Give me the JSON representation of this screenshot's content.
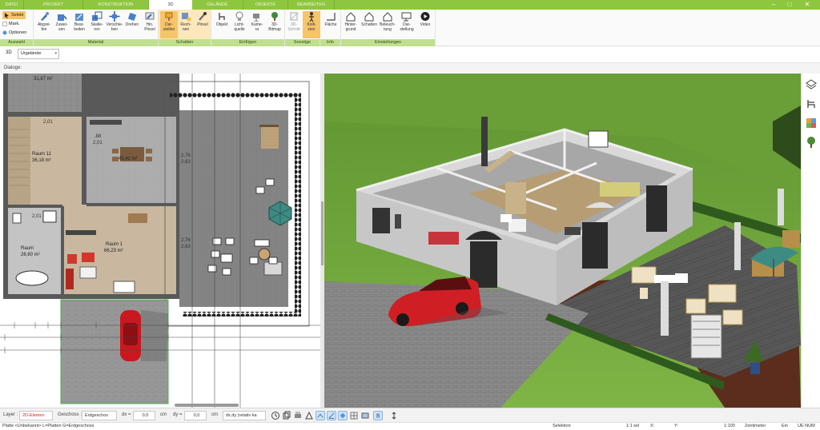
{
  "tabs": [
    {
      "label": "DATEI"
    },
    {
      "label": "PROJEKT"
    },
    {
      "label": "KONSTRUKTION"
    },
    {
      "label": "3D"
    },
    {
      "label": "GELÄNDE"
    },
    {
      "label": "OBJEKTE"
    },
    {
      "label": "BEARBEITEN"
    }
  ],
  "window_controls": {
    "minimize": "–",
    "maximize": "□",
    "close": "✕"
  },
  "ribbon": {
    "auswahl": {
      "label": "Auswahl",
      "selekt": "Selekt",
      "mark": "Mark.",
      "optionen": "Optionen"
    },
    "material": {
      "label": "Material",
      "buttons": [
        "Abgrei-\nfen",
        "Zuwei-\nsen",
        "Bear-\nbeiten",
        "Skalie-\nren",
        "Verschie-\nben",
        "Drehen",
        "Hin.\nPinsel"
      ]
    },
    "schatten": {
      "label": "Schatten",
      "buttons": [
        "Dar-\nstellen",
        "Rech-\nnen",
        "Pinsel"
      ]
    },
    "einfuegen": {
      "label": "Einfügen",
      "buttons": [
        "Objekt",
        "Licht-\nquelle",
        "Kame-\nra",
        "3D-\nBitmap"
      ]
    },
    "sonstige": {
      "label": "Sonstige",
      "buttons": [
        "3D-\nSchnitt",
        "Kolli-\nsion"
      ]
    },
    "info": {
      "label": "Info",
      "buttons": [
        "Fläche"
      ]
    },
    "einstellungen": {
      "label": "Einstellungen",
      "buttons": [
        "Hinter-\ngrund",
        "Schatten",
        "Beleuch-\ntung",
        "Dar-\nstellung",
        "Video"
      ]
    }
  },
  "viewbar": {
    "mode": "3D",
    "terrain_select": "Urgelände"
  },
  "dialog_label": "Dialoge:",
  "plan": {
    "rooms": [
      {
        "name": "",
        "area": "31,87 m²"
      },
      {
        "name": "Raum 11",
        "area": "36,18 m²"
      },
      {
        "name": "",
        "area": "45,42 m²"
      },
      {
        "name": "Raum 1",
        "area": "66,23 m²"
      },
      {
        "name": "Raum",
        "area": "26,60 m²"
      }
    ],
    "dims": [
      "2,01",
      ",88",
      "2,01",
      "2,76",
      "2,63",
      "2,76",
      "2,63",
      "2,01"
    ]
  },
  "propbar": {
    "layer_label": "Layer :",
    "layer_value": "2D-Elemen",
    "geschoss_label": "Geschoss :",
    "geschoss_value": "Erdgeschos",
    "dx_label": "dx =",
    "dx_value": "0,0",
    "dx_unit": "cm",
    "dy_label": "dy =",
    "dy_value": "0,0",
    "dy_unit": "cm",
    "mode_value": "dx,dy (relativ ka"
  },
  "statusbar": {
    "left": "Platte <Unbekannt> L=Platten G=Erdgeschoss",
    "mode": "Selektion",
    "ratio": "1:1 sel",
    "x": "X:",
    "y": "Y:",
    "scale": "1:100",
    "unit": "Zentimeter",
    "ein": "Ein",
    "flags": "UE NUM"
  },
  "colors": {
    "accent": "#8fc63f",
    "ribbon_active": "#f8c468",
    "grass": "#6fa137",
    "car": "#d8222a",
    "plan_floor": "#8d8d8d"
  }
}
